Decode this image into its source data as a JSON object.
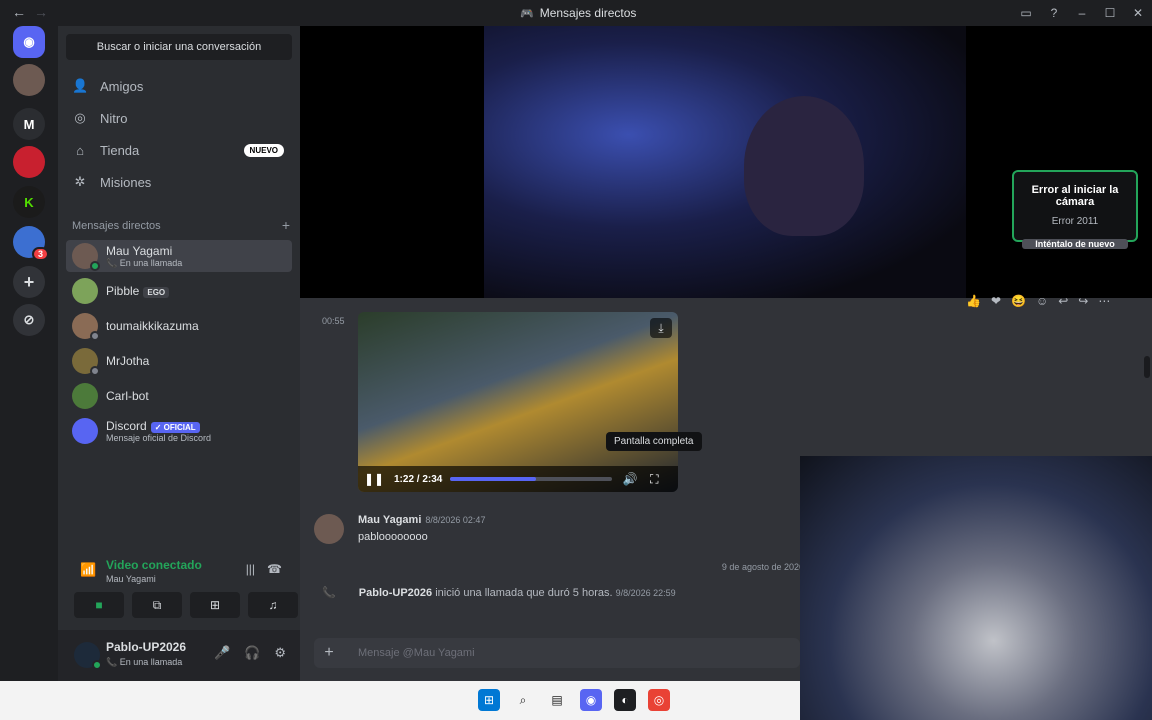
{
  "window": {
    "title": "Mensajes directos"
  },
  "search": {
    "placeholder": "Buscar o iniciar una conversación"
  },
  "nav": [
    {
      "label": "Amigos",
      "icon": "friends-icon"
    },
    {
      "label": "Nitro",
      "icon": "nitro-icon"
    },
    {
      "label": "Tienda",
      "icon": "shop-icon",
      "badge": "NUEVO"
    },
    {
      "label": "Misiones",
      "icon": "quests-icon"
    }
  ],
  "dm_header": {
    "label": "Mensajes directos",
    "add": "+"
  },
  "dms": [
    {
      "name": "Mau Yagami",
      "sub": "En una llamada",
      "active": true
    },
    {
      "name": "Pibble",
      "tag": "EGO"
    },
    {
      "name": "toumaikkikazuma"
    },
    {
      "name": "MrJotha"
    },
    {
      "name": "Carl-bot"
    },
    {
      "name": "Discord",
      "tag": "✓ OFICIAL",
      "sub": "Mensaje oficial de Discord"
    }
  ],
  "servers": {
    "m_label": "M",
    "badge": "3"
  },
  "voice": {
    "status": "Video conectado",
    "channel": "Mau Yagami"
  },
  "user": {
    "name": "Pablo-UP2026",
    "status": "En una llamada"
  },
  "call": {
    "camera_error_title": "Error al iniciar la cámara",
    "camera_error_code": "Error 2011",
    "retry_label": "Inténtalo de nuevo"
  },
  "messages": {
    "timestamp": "00:55",
    "video": {
      "time": "1:22 / 2:34",
      "progress": 0.53,
      "tooltip": "Pantalla completa"
    },
    "msg2": {
      "author": "Mau Yagami",
      "date": "8/8/2026 02:47",
      "body": "pabloooooooo"
    },
    "divider": "9 de agosto de 2026",
    "call_log": {
      "author": "Pablo-UP2026",
      "text": "inició una llamada que duró 5 horas.",
      "date": "9/8/2026 22:59"
    }
  },
  "composer": {
    "placeholder": "Mensaje @Mau Yagami"
  },
  "colors": {
    "accent": "#5865f2",
    "online": "#23a55a",
    "danger": "#f23f42"
  }
}
